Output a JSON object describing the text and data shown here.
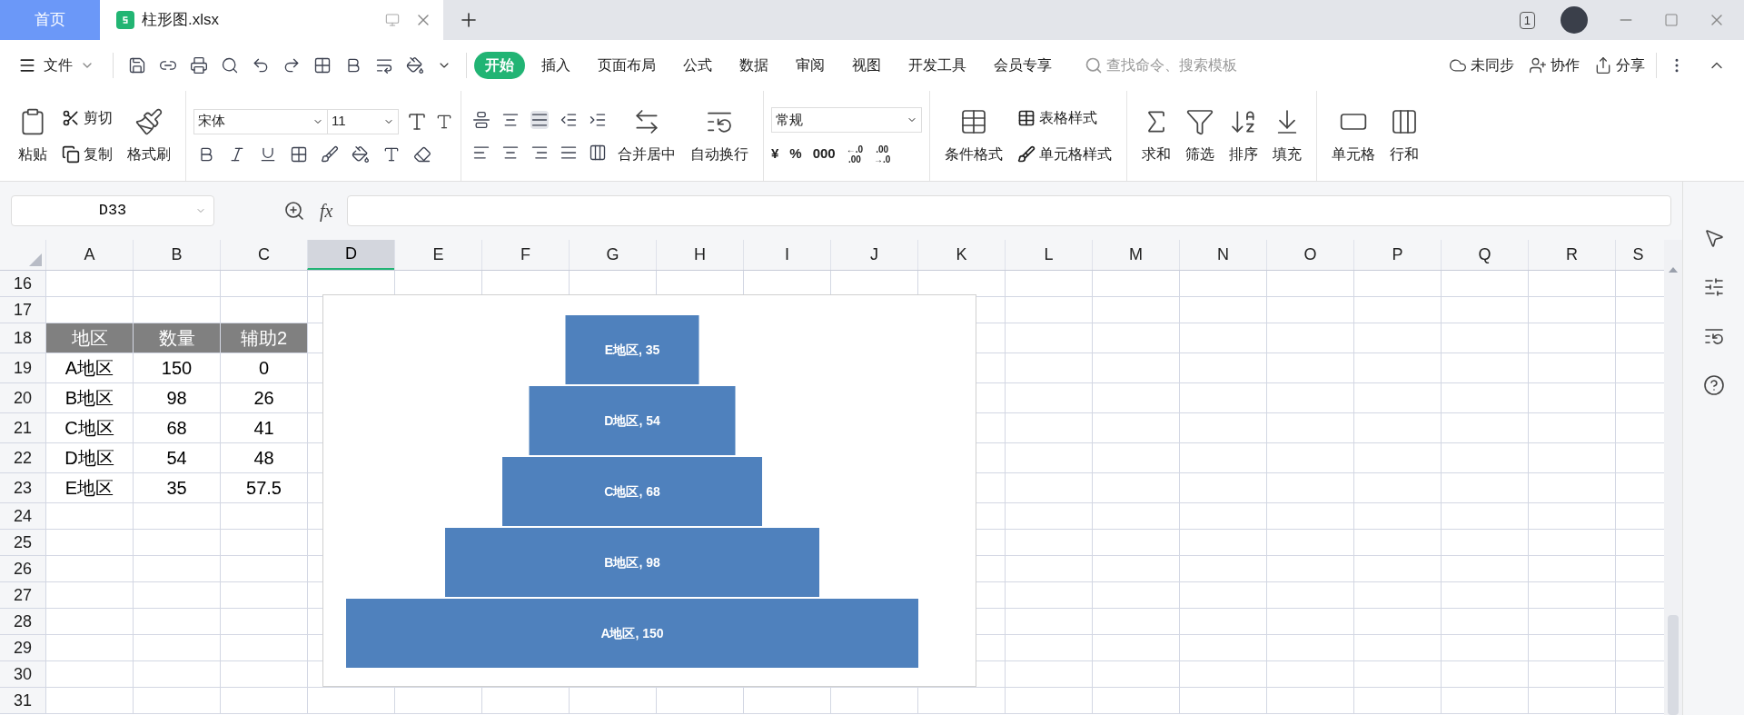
{
  "tabs": [
    {
      "label": "首页",
      "kind": "home",
      "selected": false
    },
    {
      "label": "柱形图.xlsx",
      "kind": "file",
      "selected": true
    }
  ],
  "page_count": "1",
  "menu": {
    "file": "文件",
    "tabs": [
      {
        "label": "开始",
        "selected": true
      },
      {
        "label": "插入",
        "selected": false
      },
      {
        "label": "页面布局",
        "selected": false
      },
      {
        "label": "公式",
        "selected": false
      },
      {
        "label": "数据",
        "selected": false
      },
      {
        "label": "审阅",
        "selected": false
      },
      {
        "label": "视图",
        "selected": false
      },
      {
        "label": "开发工具",
        "selected": false
      },
      {
        "label": "会员专享",
        "selected": false
      }
    ],
    "search": {
      "placeholder": "查找命令、搜索模板"
    },
    "actions": [
      "未同步",
      "协作",
      "分享"
    ]
  },
  "ribbon": {
    "paste": "粘贴",
    "cut": "剪切",
    "copy": "复制",
    "format_painter": "格式刷",
    "font": "宋体",
    "font_size": "11",
    "merge": "合并居中",
    "wrap": "自动换行",
    "number_format": "常规",
    "number_buttons": [
      "¥",
      "%",
      "000"
    ],
    "decimal_buttons": [
      [
        "←.0",
        ".00"
      ],
      [
        ".00",
        "→.0"
      ]
    ],
    "table_style": "表格样式",
    "conditional": "条件格式",
    "cell_style": "单元格样式",
    "tools": [
      "求和",
      "筛选",
      "排序",
      "填充"
    ],
    "cell": "单元格",
    "rows_cols": "行和"
  },
  "formula_bar": {
    "name_box": "D33",
    "fx": "fx"
  },
  "sheet": {
    "columns": [
      {
        "label": "A",
        "selected": false
      },
      {
        "label": "B",
        "selected": false
      },
      {
        "label": "C",
        "selected": false
      },
      {
        "label": "D",
        "selected": true
      },
      {
        "label": "E",
        "selected": false
      },
      {
        "label": "F",
        "selected": false
      },
      {
        "label": "G",
        "selected": false
      },
      {
        "label": "H",
        "selected": false
      },
      {
        "label": "I",
        "selected": false
      },
      {
        "label": "J",
        "selected": false
      },
      {
        "label": "K",
        "selected": false
      },
      {
        "label": "L",
        "selected": false
      },
      {
        "label": "M",
        "selected": false
      },
      {
        "label": "N",
        "selected": false
      },
      {
        "label": "O",
        "selected": false
      },
      {
        "label": "P",
        "selected": false
      },
      {
        "label": "Q",
        "selected": false
      },
      {
        "label": "R",
        "selected": false
      },
      {
        "label": "S",
        "selected": false
      }
    ],
    "rows": [
      {
        "number": "16",
        "kind": "blank",
        "cells": []
      },
      {
        "number": "17",
        "kind": "blank",
        "cells": []
      },
      {
        "number": "18",
        "kind": "header",
        "cells": [
          "地区",
          "数量",
          "辅助2"
        ]
      },
      {
        "number": "19",
        "kind": "data",
        "cells": [
          "A地区",
          "150",
          "0"
        ]
      },
      {
        "number": "20",
        "kind": "data",
        "cells": [
          "B地区",
          "98",
          "26"
        ]
      },
      {
        "number": "21",
        "kind": "data",
        "cells": [
          "C地区",
          "68",
          "41"
        ]
      },
      {
        "number": "22",
        "kind": "data",
        "cells": [
          "D地区",
          "54",
          "48"
        ]
      },
      {
        "number": "23",
        "kind": "data",
        "cells": [
          "E地区",
          "35",
          "57.5"
        ]
      },
      {
        "number": "24",
        "kind": "blank",
        "cells": []
      },
      {
        "number": "25",
        "kind": "blank",
        "cells": []
      },
      {
        "number": "26",
        "kind": "blank",
        "cells": []
      },
      {
        "number": "27",
        "kind": "blank",
        "cells": []
      },
      {
        "number": "28",
        "kind": "blank",
        "cells": []
      },
      {
        "number": "29",
        "kind": "blank",
        "cells": []
      },
      {
        "number": "30",
        "kind": "blank",
        "cells": []
      },
      {
        "number": "31",
        "kind": "blank",
        "cells": []
      }
    ],
    "chart": {
      "bar_labels": [
        "E地区, 35",
        "D地区, 54",
        "C地区, 68",
        "B地区, 98",
        "A地区, 150"
      ]
    }
  }
}
